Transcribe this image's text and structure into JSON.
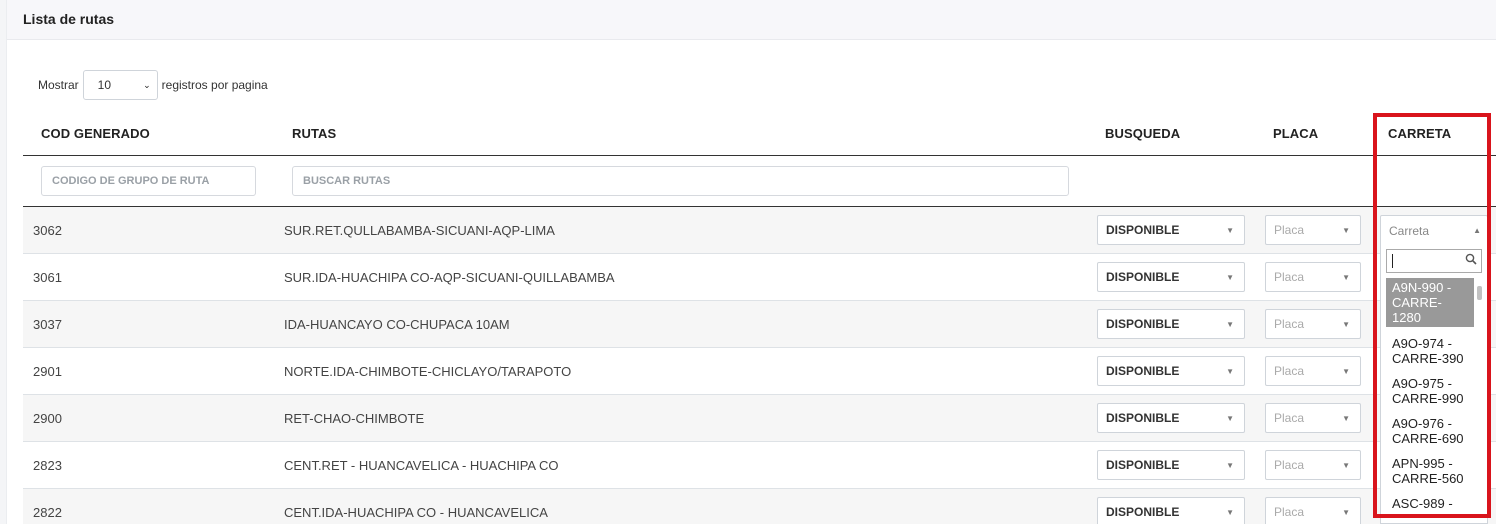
{
  "card": {
    "title": "Lista de rutas"
  },
  "length": {
    "prefix": "Mostrar",
    "value": "10",
    "suffix": "registros por pagina"
  },
  "columns": {
    "cod": "COD GENERADO",
    "rutas": "RUTAS",
    "busqueda": "BUSQUEDA",
    "placa": "PLACA",
    "carreta": "CARRETA"
  },
  "filters": {
    "cod_placeholder": "CODIGO DE GRUPO DE RUTA",
    "rutas_placeholder": "BUSCAR RUTAS"
  },
  "rows": [
    {
      "code": "3062",
      "ruta": "SUR.RET.QULLABAMBA-SICUANI-AQP-LIMA",
      "busqueda": "DISPONIBLE",
      "placa": "Placa"
    },
    {
      "code": "3061",
      "ruta": "SUR.IDA-HUACHIPA CO-AQP-SICUANI-QUILLABAMBA",
      "busqueda": "DISPONIBLE",
      "placa": "Placa"
    },
    {
      "code": "3037",
      "ruta": "IDA-HUANCAYO CO-CHUPACA 10AM",
      "busqueda": "DISPONIBLE",
      "placa": "Placa"
    },
    {
      "code": "2901",
      "ruta": "NORTE.IDA-CHIMBOTE-CHICLAYO/TARAPOTO",
      "busqueda": "DISPONIBLE",
      "placa": "Placa"
    },
    {
      "code": "2900",
      "ruta": "RET-CHAO-CHIMBOTE",
      "busqueda": "DISPONIBLE",
      "placa": "Placa"
    },
    {
      "code": "2823",
      "ruta": "CENT.RET - HUANCAVELICA - HUACHIPA CO",
      "busqueda": "DISPONIBLE",
      "placa": "Placa"
    },
    {
      "code": "2822",
      "ruta": "CENT.IDA-HUACHIPA CO - HUANCAVELICA",
      "busqueda": "DISPONIBLE",
      "placa": "Placa"
    }
  ],
  "carreta_dropdown": {
    "placeholder": "Carreta",
    "search_value": "",
    "options": [
      {
        "lines": [
          "A9N-990 -",
          "CARRE-",
          "1280"
        ]
      },
      {
        "lines": [
          "A9O-974 -",
          "CARRE-390"
        ]
      },
      {
        "lines": [
          "A9O-975 -",
          "CARRE-990"
        ]
      },
      {
        "lines": [
          "A9O-976 -",
          "CARRE-690"
        ]
      },
      {
        "lines": [
          "APN-995 -",
          "CARRE-560"
        ]
      },
      {
        "lines": [
          "ASC-989 -"
        ]
      }
    ],
    "selected_index": 0
  },
  "colors": {
    "highlight": "#d9141c",
    "selected_option_bg": "#999999"
  },
  "icons": {
    "search": "search-icon",
    "caret": "caret-down-icon"
  }
}
